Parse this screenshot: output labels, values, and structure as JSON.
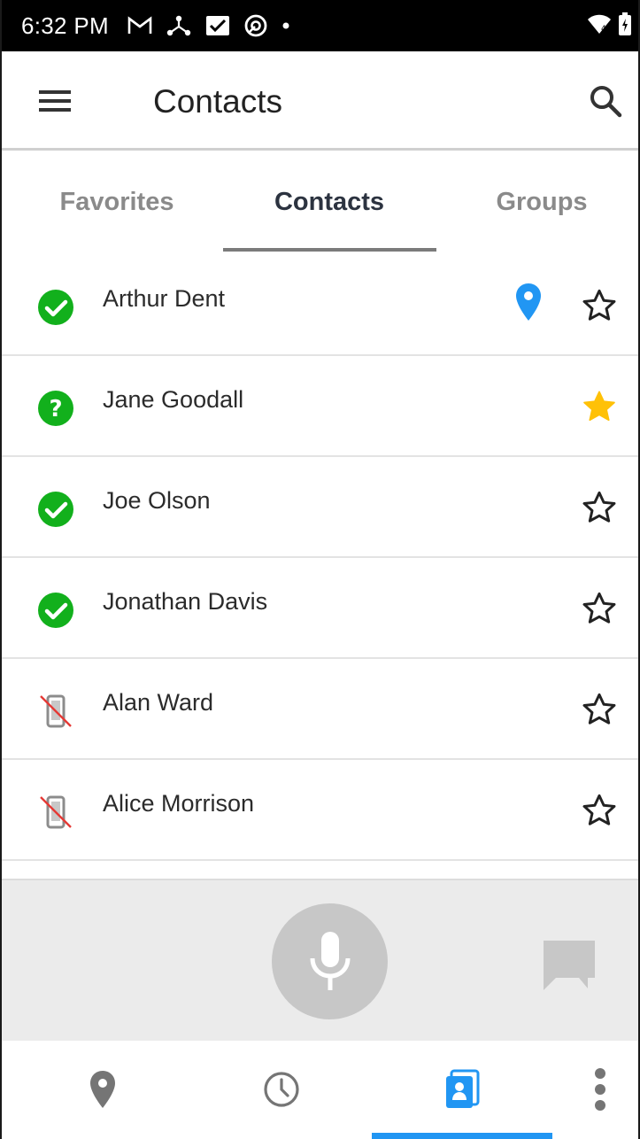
{
  "status_bar": {
    "time": "6:32 PM",
    "icons": [
      "gmail-icon",
      "network-icon",
      "inbox-check-icon",
      "vpn-icon",
      "dot-icon"
    ],
    "right_icons": [
      "wifi-icon",
      "battery-icon"
    ]
  },
  "app_bar": {
    "title": "Contacts",
    "menu_icon": "hamburger-menu-icon",
    "search_icon": "search-icon"
  },
  "tabs": [
    {
      "label": "Favorites",
      "active": false
    },
    {
      "label": "Contacts",
      "active": true
    },
    {
      "label": "Groups",
      "active": false
    }
  ],
  "contacts": [
    {
      "name": "Arthur Dent",
      "status": "online",
      "location": true,
      "favorite": false
    },
    {
      "name": "Jane Goodall",
      "status": "unknown",
      "location": false,
      "favorite": true
    },
    {
      "name": "Joe Olson",
      "status": "online",
      "location": false,
      "favorite": false
    },
    {
      "name": "Jonathan Davis",
      "status": "online",
      "location": false,
      "favorite": false
    },
    {
      "name": "Alan Ward",
      "status": "no-device",
      "location": false,
      "favorite": false
    },
    {
      "name": "Alice Morrison",
      "status": "no-device",
      "location": false,
      "favorite": false
    }
  ],
  "actions": {
    "mic_icon": "microphone-icon",
    "chat_icon": "chat-icon"
  },
  "bottom_nav": [
    {
      "icon": "map-pin-icon",
      "active": false
    },
    {
      "icon": "history-clock-icon",
      "active": false
    },
    {
      "icon": "contacts-book-icon",
      "active": true
    },
    {
      "icon": "more-vert-icon",
      "active": false
    }
  ],
  "colors": {
    "online_green": "#12b01c",
    "favorite_yellow": "#ffc107",
    "location_blue": "#2196f3",
    "active_tab": "#2c3340",
    "nav_active": "#2196f3"
  }
}
